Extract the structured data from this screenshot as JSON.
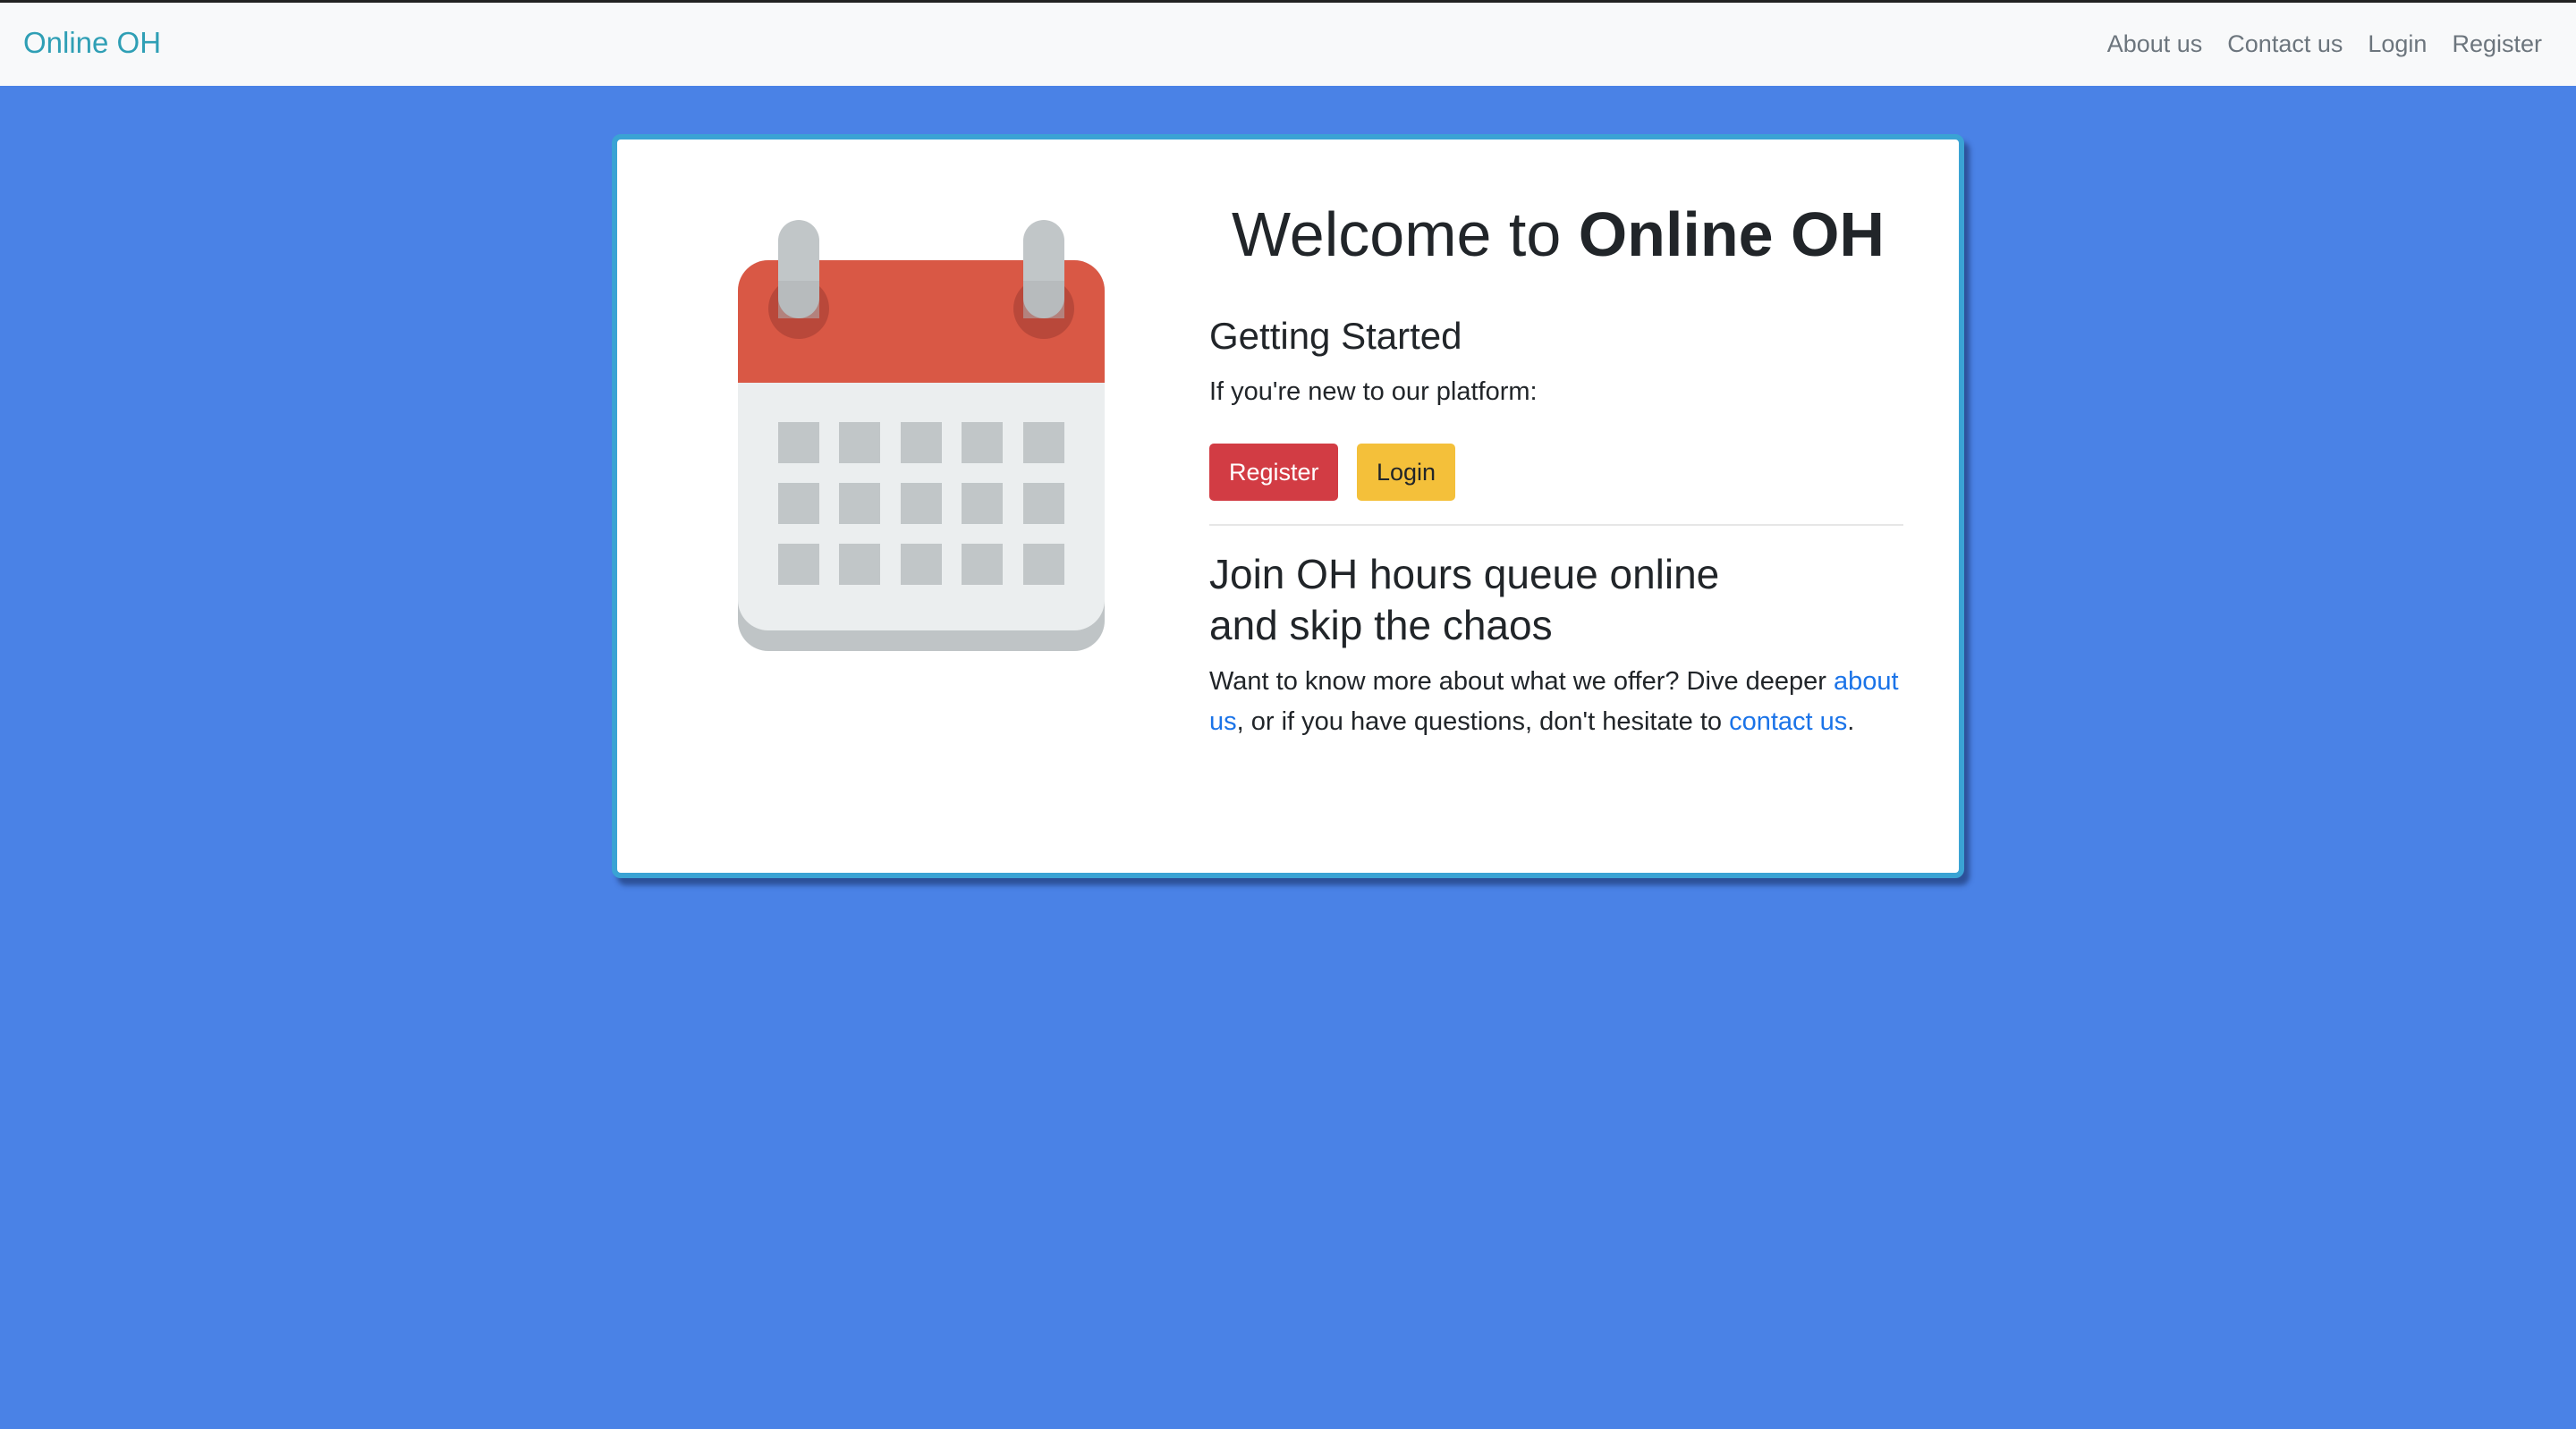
{
  "navbar": {
    "brand": "Online OH",
    "links": [
      "About us",
      "Contact us",
      "Login",
      "Register"
    ]
  },
  "hero": {
    "welcome_prefix": "Welcome to ",
    "welcome_brand": "Online OH",
    "getting_started": "Getting Started",
    "intro": "If you're new to our platform:",
    "register_label": "Register",
    "login_label": "Login",
    "join_line1": "Join OH hours queue online",
    "join_line2": "and skip the chaos",
    "more_text_1": "Want to know more about what we offer? Dive deeper ",
    "about_link": "about us",
    "more_text_2": ", or if you have questions, don't hesitate to ",
    "contact_link": "contact us",
    "more_text_3": "."
  },
  "icons": {
    "calendar": "calendar-icon"
  },
  "colors": {
    "background": "#4a82e6",
    "brand": "#2f9fb5",
    "card_border": "#3aa3d4",
    "register_button": "#d23c44",
    "login_button": "#f4c03a",
    "link": "#1a73e8"
  }
}
